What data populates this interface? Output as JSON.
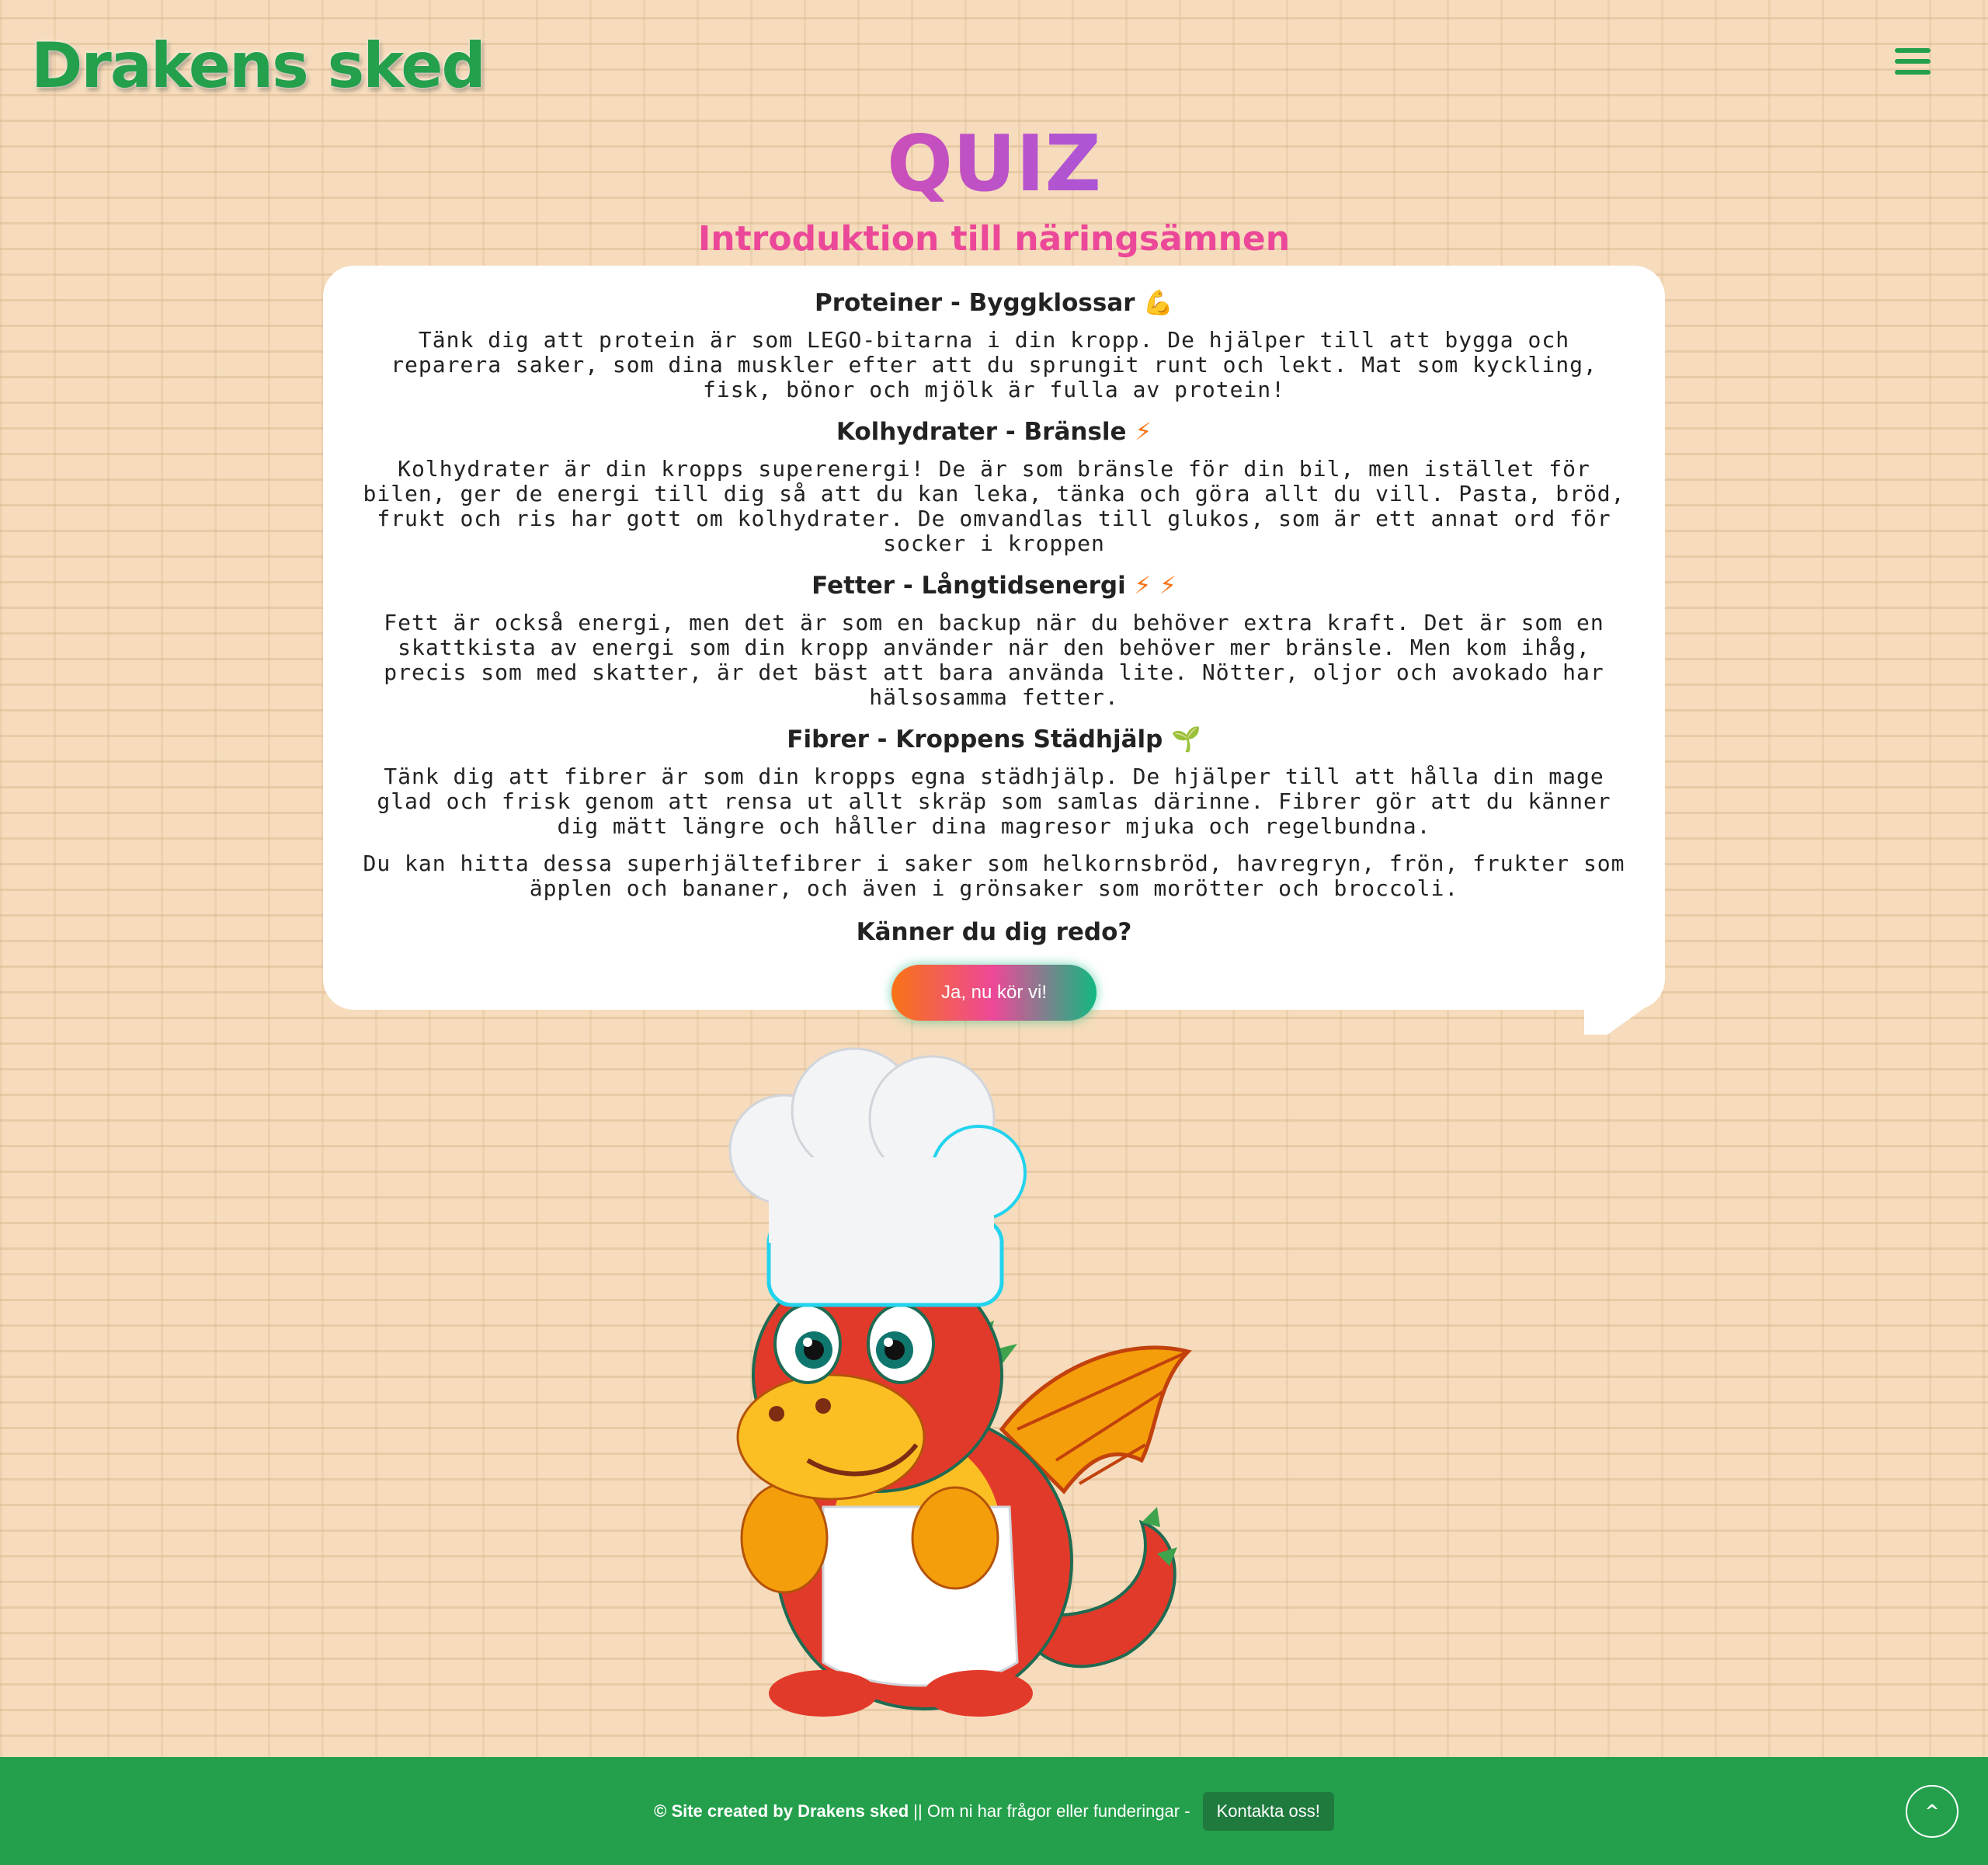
{
  "header": {
    "logo_text": "Drakens sked",
    "menu_icon": "hamburger-icon"
  },
  "page": {
    "title": "QUIZ",
    "subtitle": "Introduktion till näringsämnen"
  },
  "card": {
    "sections": [
      {
        "heading": "Proteiner - Byggklossar",
        "emoji": "💪",
        "text": "Tänk dig att protein är som LEGO-bitarna i din kropp. De hjälper till att bygga och reparera saker, som dina muskler efter att du sprungit runt och lekt. Mat som kyckling, fisk, bönor och mjölk är fulla av protein!"
      },
      {
        "heading": "Kolhydrater - Bränsle",
        "emoji": "⚡",
        "text": "Kolhydrater är din kropps superenergi! De är som bränsle för din bil, men istället för bilen, ger de energi till dig så att du kan leka, tänka och göra allt du vill. Pasta, bröd, frukt och ris har gott om kolhydrater. De omvandlas till glukos, som är ett annat ord för socker i kroppen"
      },
      {
        "heading": "Fetter - Långtidsenergi",
        "emoji": "⚡ ⚡",
        "text": "Fett är också energi, men det är som en backup när du behöver extra kraft. Det är som en skattkista av energi som din kropp använder när den behöver mer bränsle. Men kom ihåg, precis som med skatter, är det bäst att bara använda lite. Nötter, oljor och avokado har hälsosamma fetter."
      },
      {
        "heading": "Fibrer - Kroppens Städhjälp",
        "emoji": "🌱",
        "text": "Tänk dig att fibrer är som din kropps egna städhjälp. De hjälper till att hålla din mage glad och frisk genom att rensa ut allt skräp som samlas därinne. Fibrer gör att du känner dig mätt längre och håller dina magresor mjuka och regelbundna.",
        "text2": "Du kan hitta dessa superhjältefibrer i saker som helkornsbröd, havregryn, frön, frukter som äpplen och bananer, och även i grönsaker som morötter och broccoli."
      }
    ],
    "ready_question": "Känner du dig redo?",
    "cta_label": "Ja, nu kör vi!"
  },
  "footer": {
    "credit": "© Site created by Drakens sked",
    "separator": "||",
    "question": "Om ni har frågor eller funderingar -",
    "contact_label": "Kontakta oss!",
    "to_top": "^"
  },
  "colors": {
    "brand_green": "#24a04c",
    "pink": "#ec4899",
    "background": "#f6dcbc"
  }
}
